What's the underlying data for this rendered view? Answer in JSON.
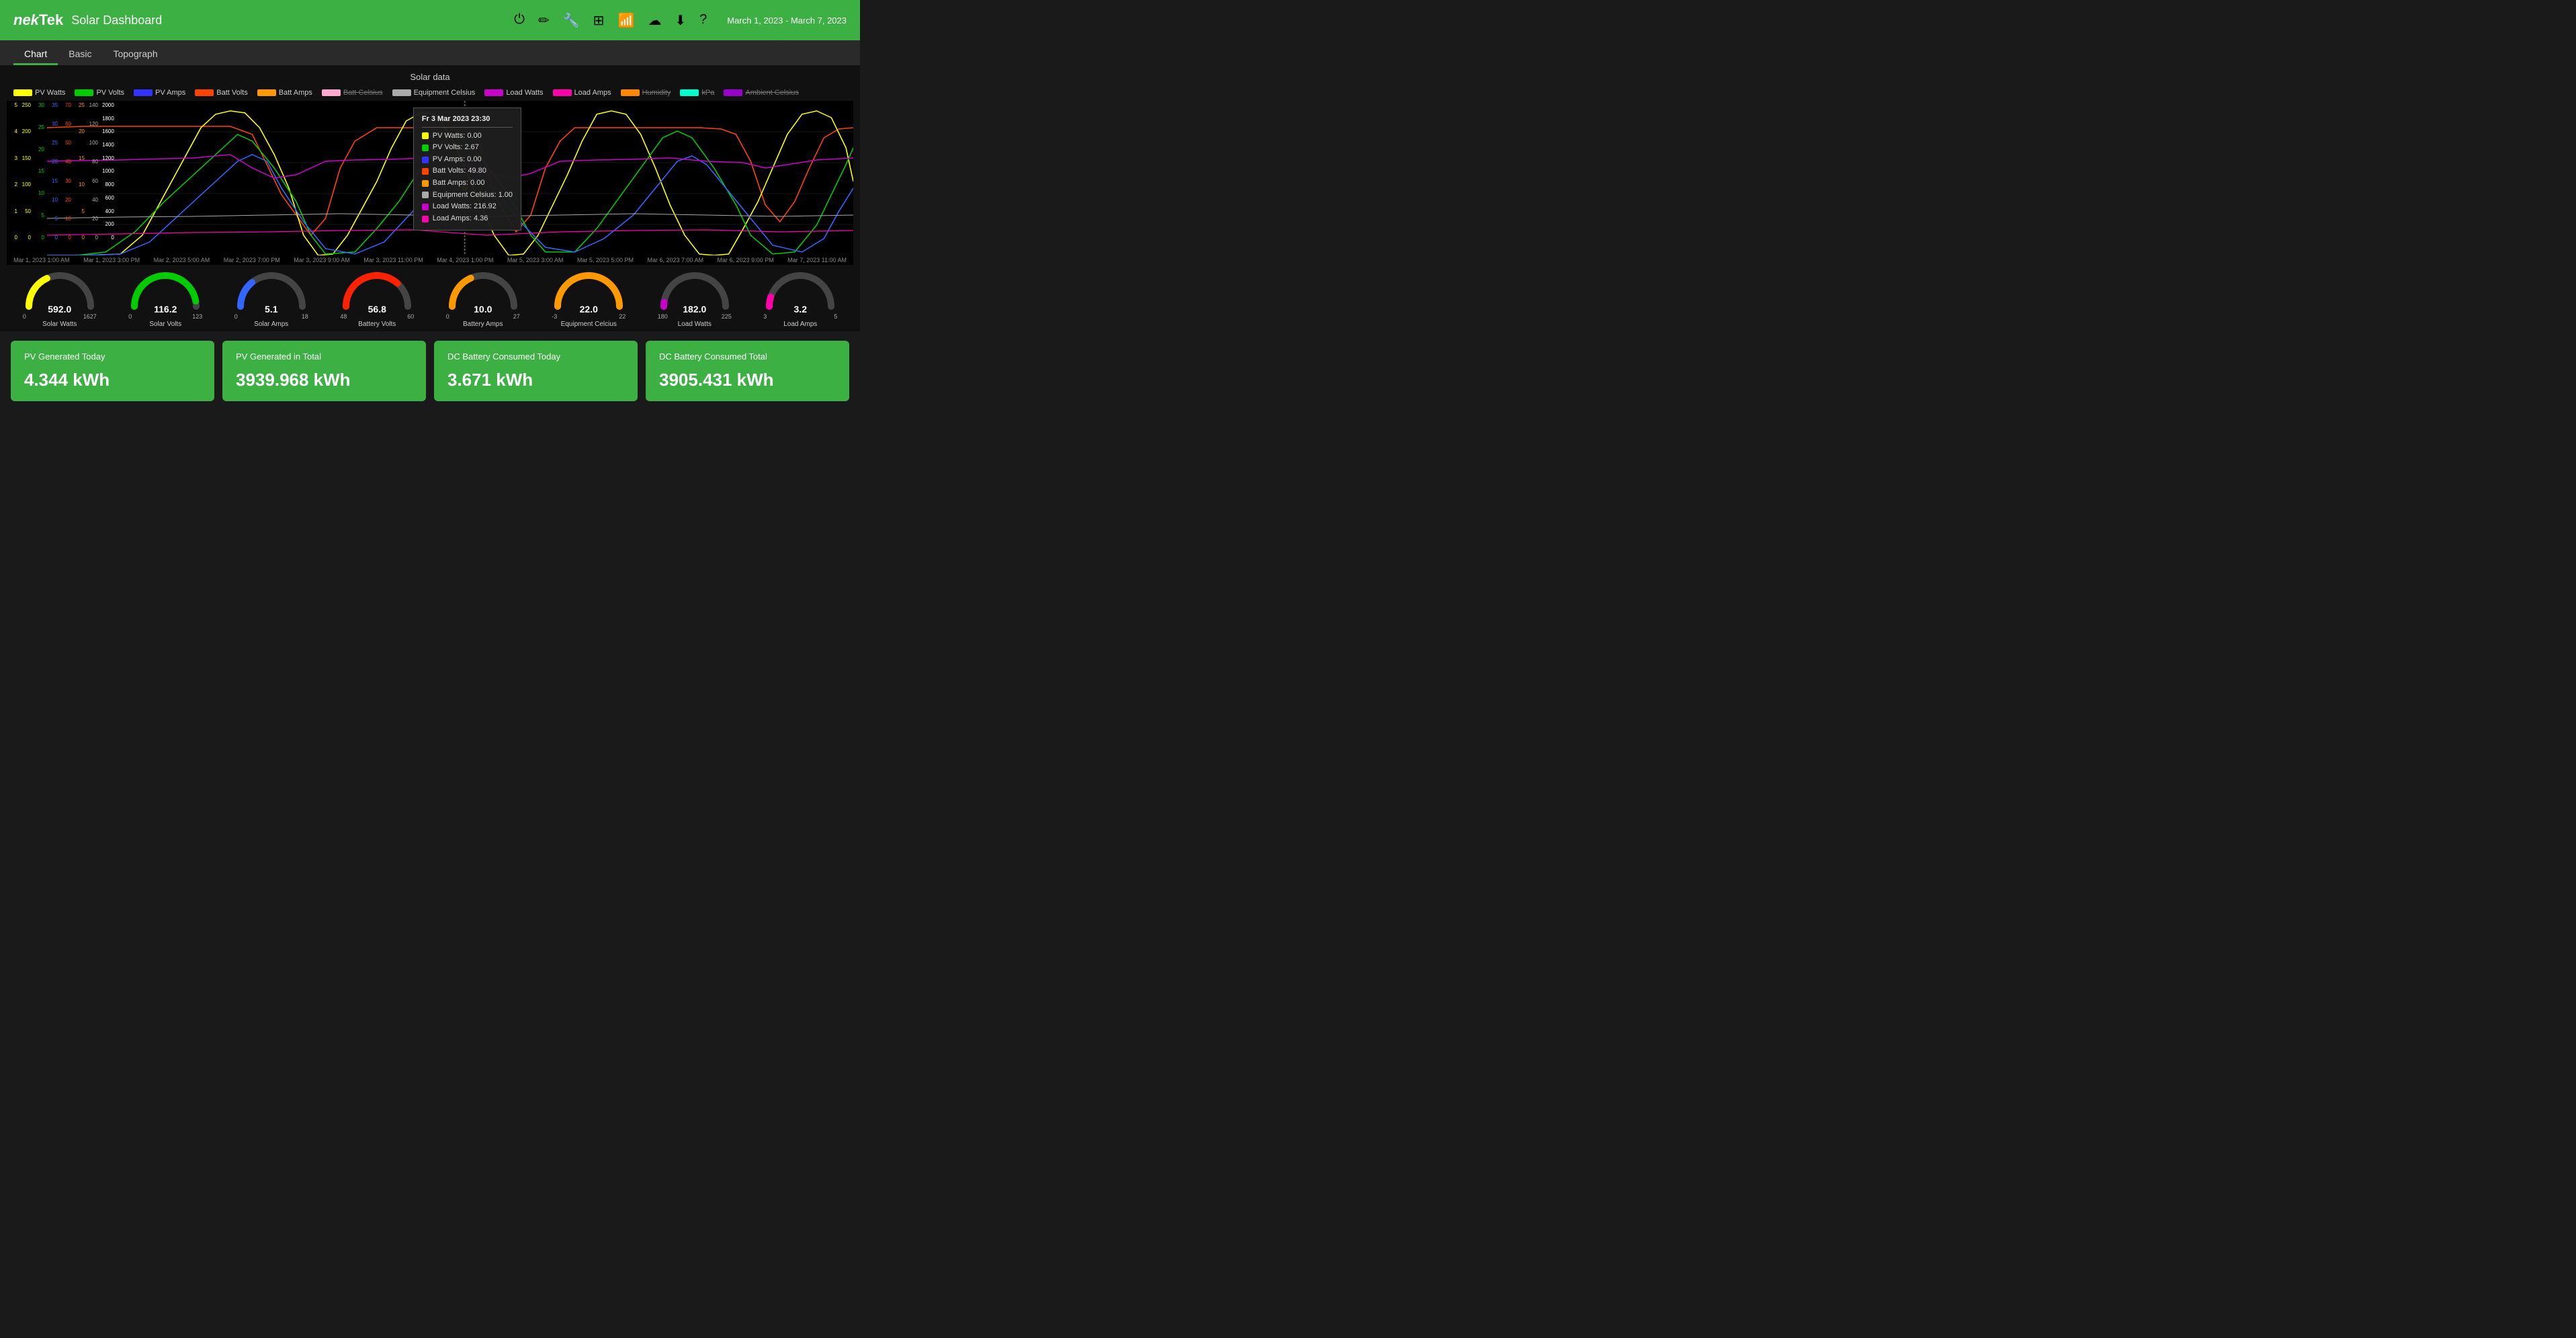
{
  "header": {
    "logo": "nekTek",
    "title": "Solar Dashboard",
    "date_range": "March 1, 2023 - March 7, 2023",
    "icons": [
      {
        "name": "power-icon",
        "symbol": "⏻"
      },
      {
        "name": "edit-icon",
        "symbol": "✏"
      },
      {
        "name": "wrench-icon",
        "symbol": "🔧"
      },
      {
        "name": "grid-icon",
        "symbol": "⊞"
      },
      {
        "name": "wifi-icon",
        "symbol": "📶"
      },
      {
        "name": "cloud-icon",
        "symbol": "☁"
      },
      {
        "name": "download-icon",
        "symbol": "⬇"
      },
      {
        "name": "help-icon",
        "symbol": "?"
      }
    ]
  },
  "nav": {
    "tabs": [
      {
        "label": "Chart",
        "active": true
      },
      {
        "label": "Basic",
        "active": false
      },
      {
        "label": "Topograph",
        "active": false
      }
    ]
  },
  "chart": {
    "title": "Solar data",
    "legend": [
      {
        "label": "PV Watts",
        "color": "#ffff00",
        "strikethrough": false
      },
      {
        "label": "PV Volts",
        "color": "#00cc00",
        "strikethrough": false
      },
      {
        "label": "PV Amps",
        "color": "#3333ff",
        "strikethrough": false
      },
      {
        "label": "Batt Volts",
        "color": "#ff4400",
        "strikethrough": false
      },
      {
        "label": "Batt Amps",
        "color": "#ff9900",
        "strikethrough": false
      },
      {
        "label": "Batt Celsius",
        "color": "#ffaacc",
        "strikethrough": true
      },
      {
        "label": "Equipment Celsius",
        "color": "#aaaaaa",
        "strikethrough": false
      },
      {
        "label": "Load Watts",
        "color": "#cc00cc",
        "strikethrough": false
      },
      {
        "label": "Load Amps",
        "color": "#ff00aa",
        "strikethrough": false
      },
      {
        "label": "Humidity",
        "color": "#ff8800",
        "strikethrough": true
      },
      {
        "label": "kPa",
        "color": "#00ffcc",
        "strikethrough": true
      },
      {
        "label": "Ambient Celsius",
        "color": "#9900cc",
        "strikethrough": true
      }
    ],
    "x_labels": [
      "Mar 1, 2023 1:00 AM",
      "Mar 1, 2023 3:00 PM",
      "Mar 2, 2023 5:00 AM",
      "Mar 2, 2023 7:00 PM",
      "Mar 3, 2023 9:00 AM",
      "Mar 3, 2023 11:00 PM",
      "Mar 4, 2023 1:00 PM",
      "Mar 5, 2023 3:00 AM",
      "Mar 5, 2023 5:00 PM",
      "Mar 6, 2023 7:00 AM",
      "Mar 6, 2023 9:00 PM",
      "Mar 7, 2023 11:00 AM"
    ],
    "tooltip": {
      "header": "Fr 3 Mar 2023 23:30",
      "rows": [
        {
          "label": "PV Watts: 0.00",
          "color": "#ffff00"
        },
        {
          "label": "PV Volts: 2.67",
          "color": "#00cc00"
        },
        {
          "label": "PV Amps: 0.00",
          "color": "#3333ff"
        },
        {
          "label": "Batt Volts: 49.80",
          "color": "#ff4400"
        },
        {
          "label": "Batt Amps: 0.00",
          "color": "#ff9900"
        },
        {
          "label": "Equipment Celsius: 1.00",
          "color": "#aaaaaa"
        },
        {
          "label": "Load Watts: 216.92",
          "color": "#cc00cc"
        },
        {
          "label": "Load Amps: 4.36",
          "color": "#ff00aa"
        }
      ]
    },
    "y_axes": [
      {
        "values": [
          "5",
          "4",
          "3",
          "2",
          "1",
          "0"
        ],
        "color": "#ffff00"
      },
      {
        "values": [
          "250",
          "200",
          "150",
          "100",
          "50",
          "0"
        ],
        "color": "#ffff00"
      },
      {
        "values": [
          "30",
          "25",
          "20",
          "15",
          "10",
          "5",
          "0"
        ],
        "color": "#00cc00"
      },
      {
        "values": [
          "35",
          "30",
          "25",
          "20",
          "15",
          "10",
          "5",
          "0"
        ],
        "color": "#3333ff"
      },
      {
        "values": [
          "70",
          "60",
          "50",
          "40",
          "30",
          "20",
          "10",
          "0"
        ],
        "color": "#ff4400"
      },
      {
        "values": [
          "25",
          "20",
          "15",
          "10",
          "5",
          "0"
        ],
        "color": "#ff9900"
      },
      {
        "values": [
          "140",
          "120",
          "100",
          "80",
          "60",
          "40",
          "20",
          "0"
        ],
        "color": "#aaaaaa"
      },
      {
        "values": [
          "2000",
          "1800",
          "1600",
          "1400",
          "1200",
          "1000",
          "800",
          "600",
          "400",
          "200",
          "0"
        ],
        "color": "#ffffff"
      }
    ]
  },
  "gauges": [
    {
      "label": "Solar Watts",
      "value": "592.0",
      "min": "0",
      "max": "1627",
      "color": "#ffff00",
      "percent": 0.364
    },
    {
      "label": "Solar Volts",
      "value": "116.2",
      "min": "0",
      "max": "123",
      "color": "#00cc00",
      "percent": 0.945
    },
    {
      "label": "Solar Amps",
      "value": "5.1",
      "min": "0",
      "max": "18",
      "color": "#3366ff",
      "percent": 0.283
    },
    {
      "label": "Battery Volts",
      "value": "56.8",
      "min": "48",
      "max": "60",
      "color": "#ff2200",
      "percent": 0.733
    },
    {
      "label": "Battery Amps",
      "value": "10.0",
      "min": "0",
      "max": "27",
      "color": "#ff9900",
      "percent": 0.37
    },
    {
      "label": "Equipment Celcius",
      "value": "22.0",
      "min": "-3",
      "max": "22",
      "color": "#ff9900",
      "percent": 1.0
    },
    {
      "label": "Load Watts",
      "value": "182.0",
      "min": "180",
      "max": "225",
      "color": "#cc00cc",
      "percent": 0.044
    },
    {
      "label": "Load Amps",
      "value": "3.2",
      "min": "3",
      "max": "5",
      "color": "#ff00aa",
      "percent": 0.1
    }
  ],
  "stats": [
    {
      "title": "PV Generated Today",
      "value": "4.344 kWh"
    },
    {
      "title": "PV Generated in Total",
      "value": "3939.968 kWh"
    },
    {
      "title": "DC Battery Consumed Today",
      "value": "3.671 kWh"
    },
    {
      "title": "DC Battery Consumed Total",
      "value": "3905.431 kWh"
    }
  ]
}
